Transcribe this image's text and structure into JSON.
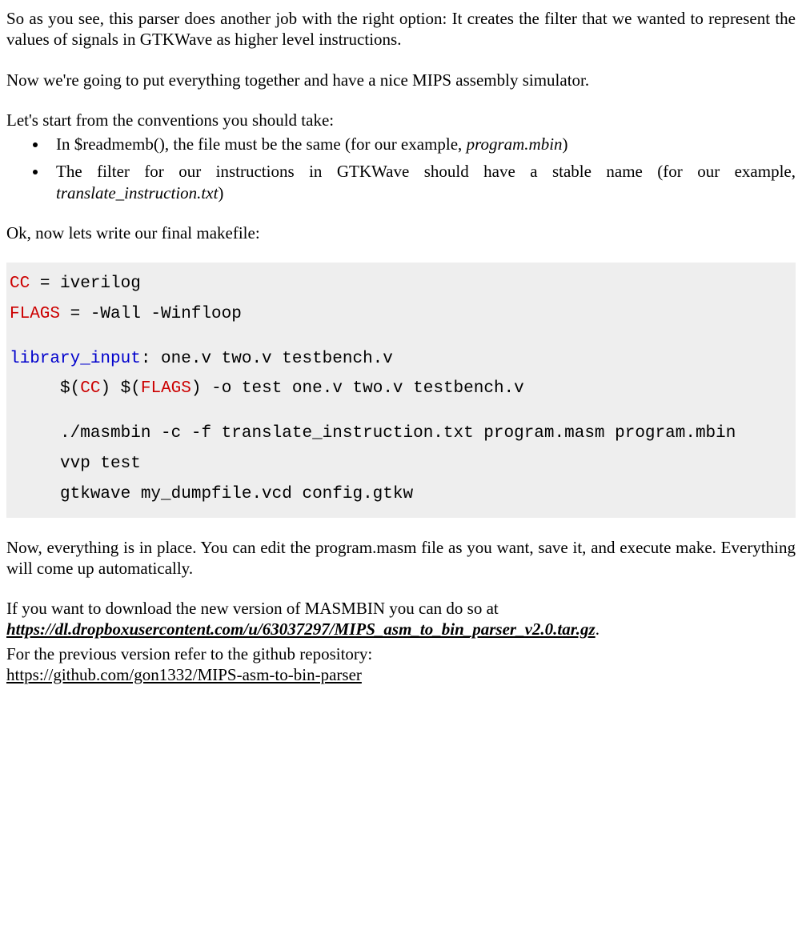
{
  "p1": "So as you see, this parser does another job with the right option: It creates the filter that we wanted to represent the values of signals in GTKWave as higher level instructions.",
  "p2": "Now we're going to put everything together and have a nice MIPS assembly simulator.",
  "p3": "Let's start from the conventions you should take:",
  "li1_a": "In $readmemb(), the file must be the same (for our example, ",
  "li1_b": "program.mbin",
  "li1_c": ")",
  "li2_a": "The filter for our instructions in GTKWave should have a stable name (for our example, ",
  "li2_b": "translate_instruction.txt",
  "li2_c": ")",
  "p4": "Ok, now lets write our final makefile:",
  "code": {
    "l1a": "CC",
    "l1b": " = iverilog",
    "l2a": "FLAGS",
    "l2b": " = -Wall -Winfloop",
    "l3a": "library_input",
    "l3b": ": one.v two.v testbench.v",
    "l4a": "     $(",
    "l4b": "CC",
    "l4c": ") $(",
    "l4d": "FLAGS",
    "l4e": ") -o test one.v two.v testbench.v",
    "l5": "     ./masmbin -c -f translate_instruction.txt program.masm program.mbin",
    "l6": "     vvp test",
    "l7": "     gtkwave my_dumpfile.vcd config.gtkw"
  },
  "p5": "Now, everything is in place. You can edit the program.masm file as you want, save it, and execute make. Everything will come up automatically.",
  "p6a": "If you want to download the new version of MASMBIN you can do so at ",
  "link1": "https://dl.dropboxusercontent.com/u/63037297/MIPS_asm_to_bin_parser_v2.0.tar.gz",
  "p6b": ".",
  "p7": "For the previous version refer to the github repository: ",
  "link2": "https://github.com/gon1332/MIPS-asm-to-bin-parser"
}
